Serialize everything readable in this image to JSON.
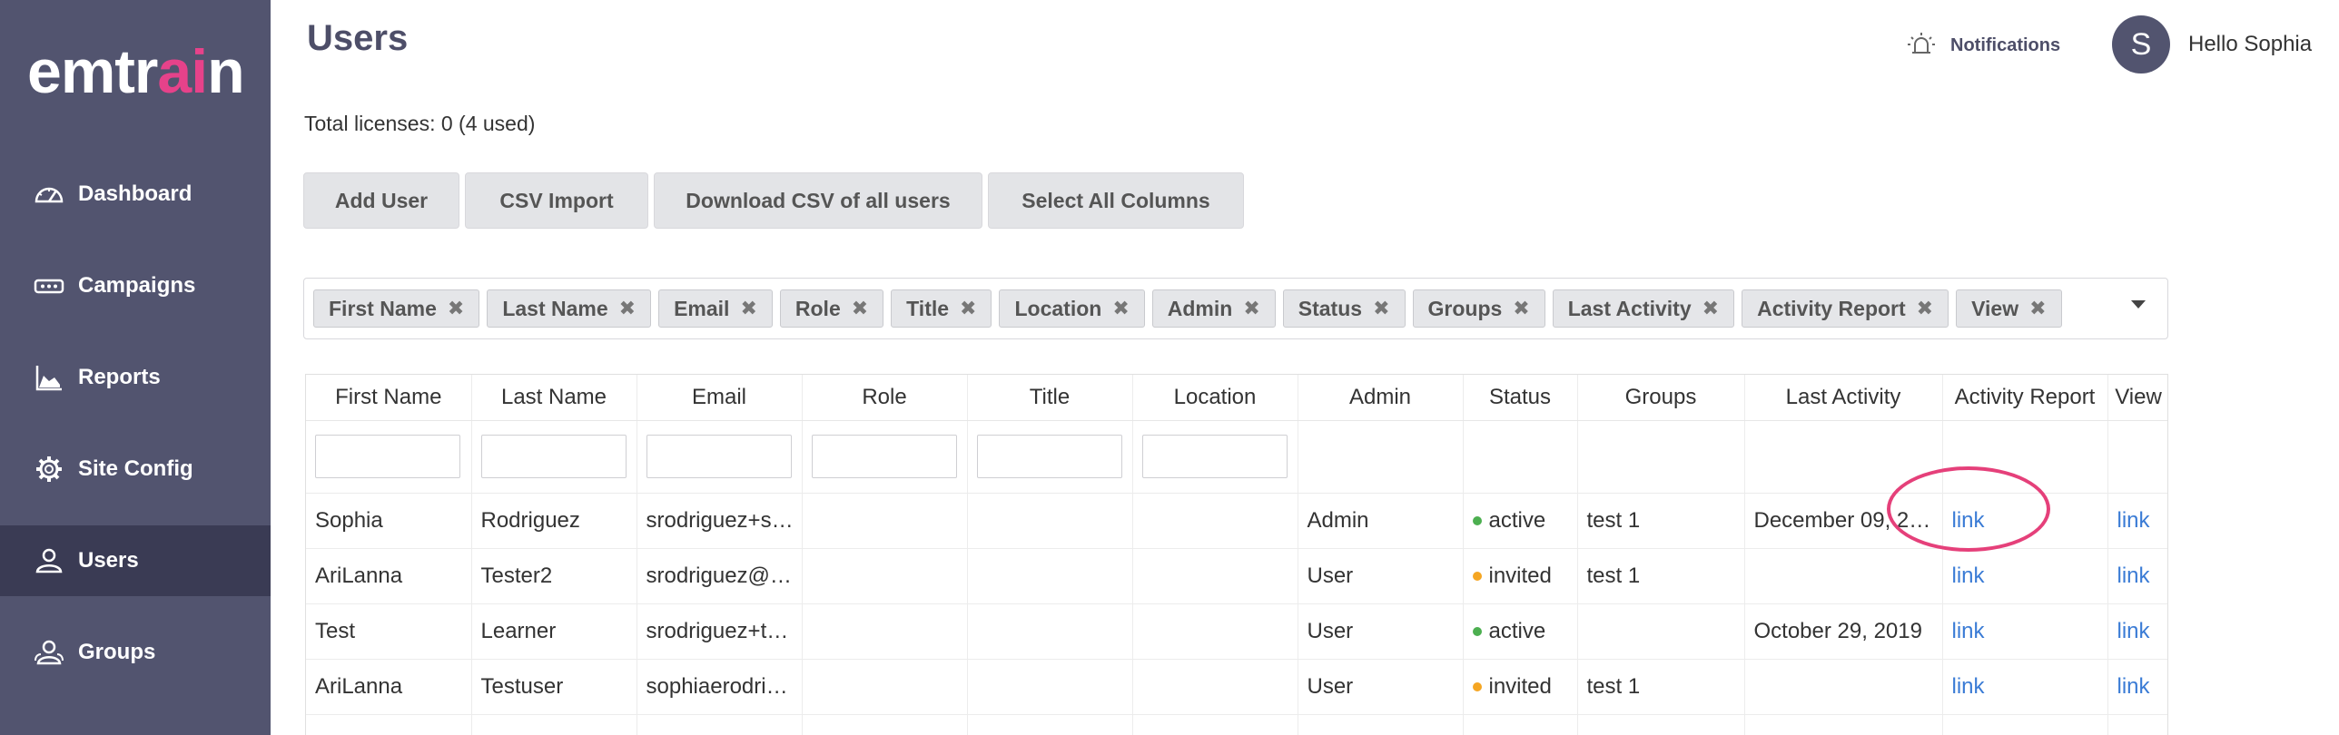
{
  "sidebar": {
    "logo_main": "emtr",
    "logo_accent": "ai",
    "logo_end": "n",
    "items": [
      {
        "label": "Dashboard",
        "icon": "gauge-icon"
      },
      {
        "label": "Campaigns",
        "icon": "ticket-icon"
      },
      {
        "label": "Reports",
        "icon": "chart-icon"
      },
      {
        "label": "Site Config",
        "icon": "gear-icon"
      },
      {
        "label": "Users",
        "icon": "user-icon",
        "active": true
      },
      {
        "label": "Groups",
        "icon": "group-icon"
      }
    ]
  },
  "header": {
    "title": "Users",
    "notifications": "Notifications",
    "avatar_initial": "S",
    "greeting": "Hello Sophia"
  },
  "licenses": "Total licenses: 0 (4 used)",
  "buttons": {
    "add_user": "Add User",
    "csv_import": "CSV Import",
    "download_csv": "Download CSV of all users",
    "select_all": "Select All Columns"
  },
  "chips": [
    "First Name",
    "Last Name",
    "Email",
    "Role",
    "Title",
    "Location",
    "Admin",
    "Status",
    "Groups",
    "Last Activity",
    "Activity Report",
    "View"
  ],
  "chip_remove_glyph": "✖",
  "table": {
    "columns": [
      "First Name",
      "Last Name",
      "Email",
      "Role",
      "Title",
      "Location",
      "Admin",
      "Status",
      "Groups",
      "Last Activity",
      "Activity Report",
      "View"
    ],
    "rows": [
      {
        "first": "Sophia",
        "last": "Rodriguez",
        "email": "srodriguez+s…",
        "role": "",
        "title": "",
        "location": "",
        "admin": "Admin",
        "status": "active",
        "groups": "test 1",
        "last_activity": "December 09, 2…",
        "report": "link",
        "view": "link"
      },
      {
        "first": "AriLanna",
        "last": "Tester2",
        "email": "srodriguez@…",
        "role": "",
        "title": "",
        "location": "",
        "admin": "User",
        "status": "invited",
        "groups": "test 1",
        "last_activity": "",
        "report": "link",
        "view": "link"
      },
      {
        "first": "Test",
        "last": "Learner",
        "email": "srodriguez+t…",
        "role": "",
        "title": "",
        "location": "",
        "admin": "User",
        "status": "active",
        "groups": "",
        "last_activity": "October 29, 2019",
        "report": "link",
        "view": "link"
      },
      {
        "first": "AriLanna",
        "last": "Testuser",
        "email": "sophiaerodri…",
        "role": "",
        "title": "",
        "location": "",
        "admin": "User",
        "status": "invited",
        "groups": "test 1",
        "last_activity": "",
        "report": "link",
        "view": "link"
      }
    ]
  },
  "colors": {
    "sidebar_bg": "#52546f",
    "sidebar_active": "#3a3b54",
    "logo_accent": "#e6428a",
    "link": "#3a7bd5",
    "status_active": "#4caf50",
    "status_invited": "#f5a623",
    "annotation": "#e5407a"
  }
}
